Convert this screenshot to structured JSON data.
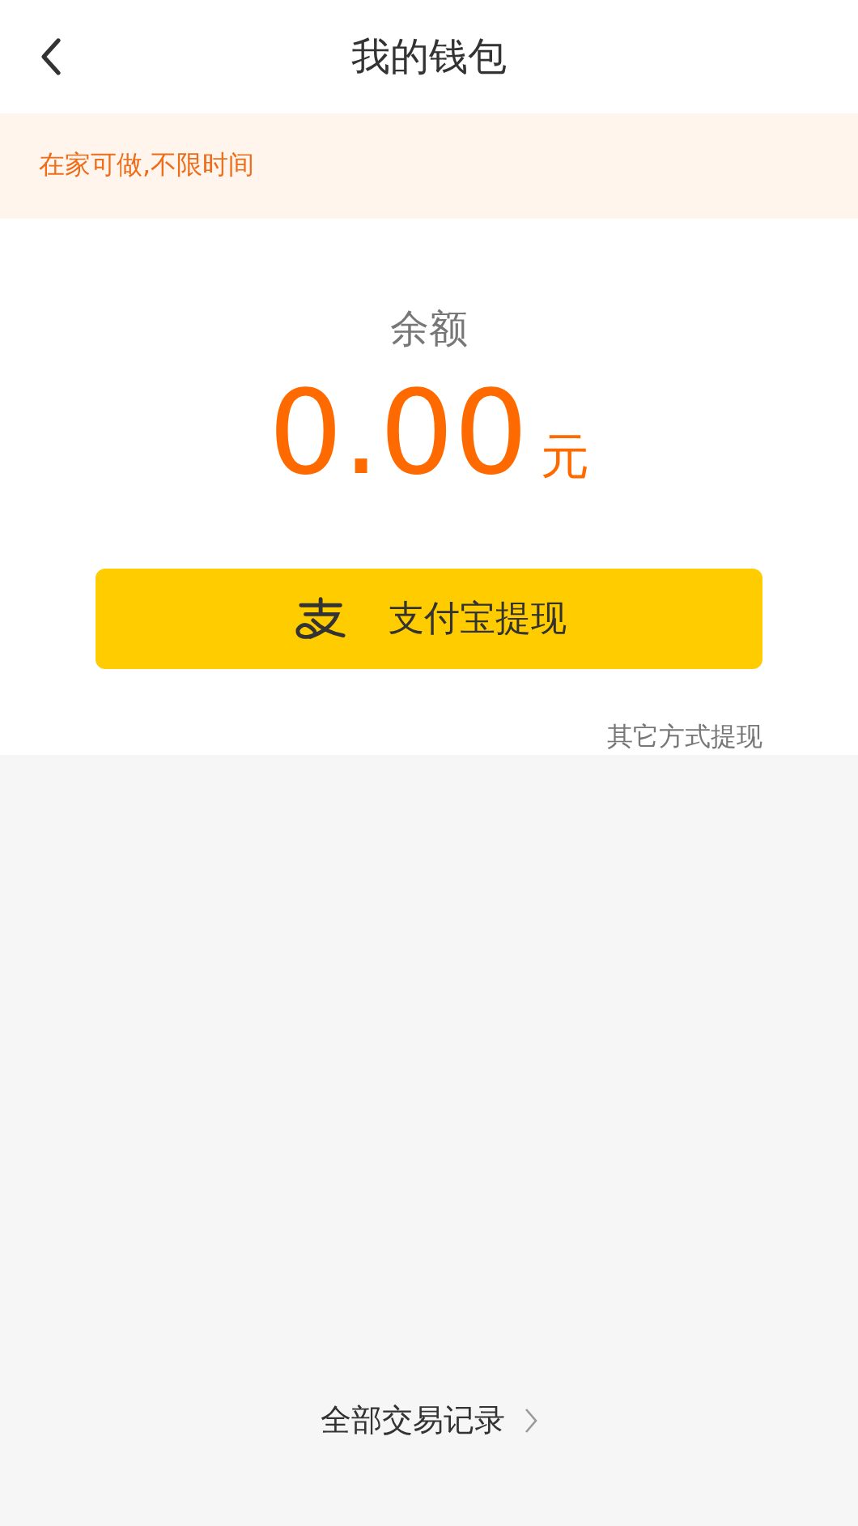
{
  "header": {
    "title": "我的钱包"
  },
  "notice": {
    "text": "在家可做,不限时间"
  },
  "balance": {
    "label": "余额",
    "amount": "0.00",
    "unit": "元"
  },
  "withdraw_button": {
    "label": "支付宝提现"
  },
  "other_methods_link": {
    "text": "其它方式提现"
  },
  "records_link": {
    "text": "全部交易记录"
  }
}
